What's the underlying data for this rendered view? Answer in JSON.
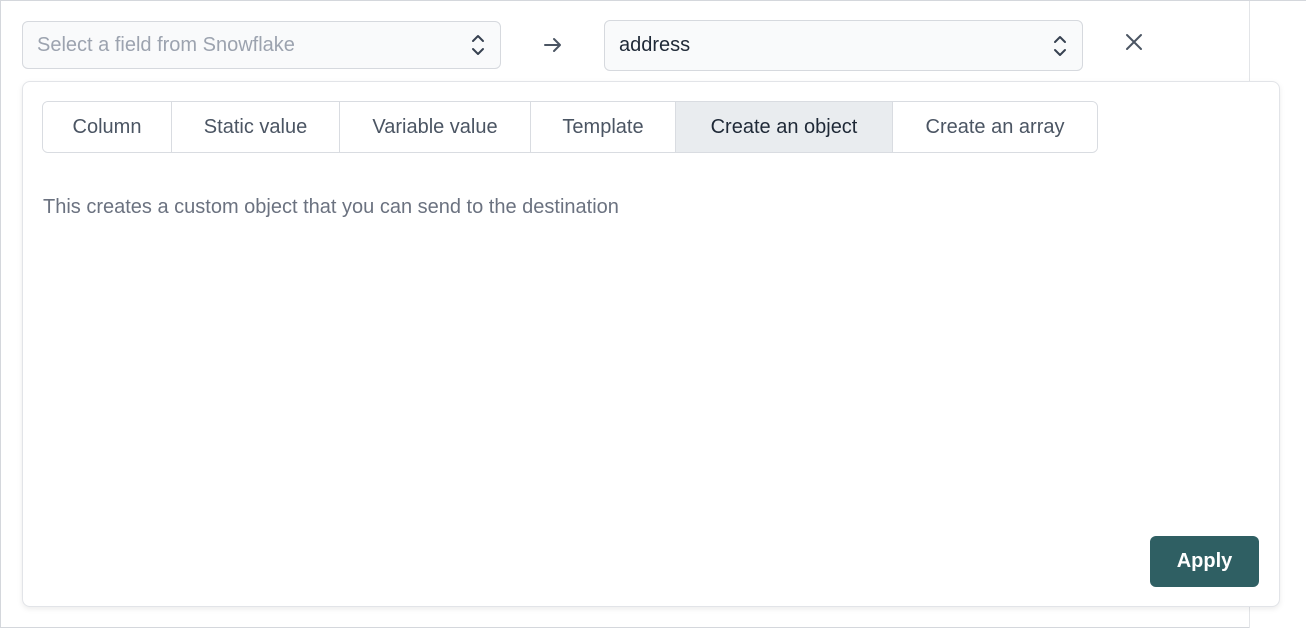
{
  "source_select": {
    "placeholder": "Select a field from Snowflake",
    "icon": "chevron-up-down-icon"
  },
  "mapping_icon": "arrow-right-icon",
  "target_select": {
    "value": "address",
    "icon": "chevron-up-down-icon"
  },
  "close_icon": "close-icon",
  "tabs": [
    {
      "label": "Column"
    },
    {
      "label": "Static value"
    },
    {
      "label": "Variable value"
    },
    {
      "label": "Template"
    },
    {
      "label": "Create an object"
    },
    {
      "label": "Create an array"
    }
  ],
  "active_tab": "Create an object",
  "description": "This creates a custom object that you can send to the destination",
  "apply_label": "Apply",
  "colors": {
    "apply_bg": "#2f5f63",
    "active_tab_bg": "#e9ecef"
  }
}
